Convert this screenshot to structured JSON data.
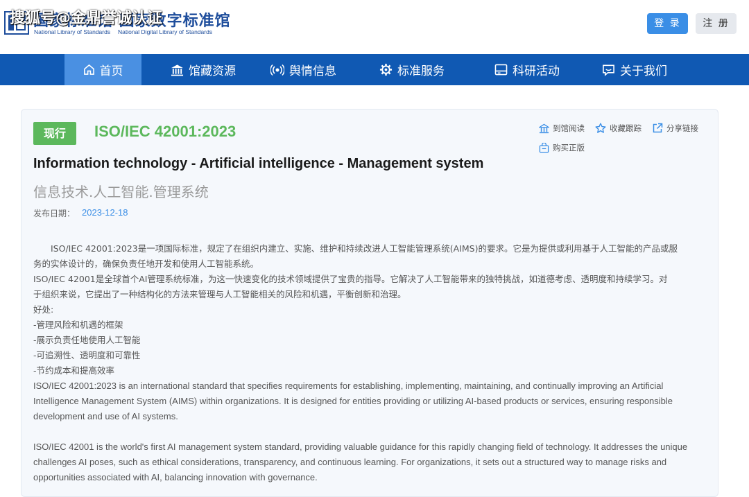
{
  "header": {
    "logo_title": "国家标准馆 国家数字标准馆",
    "logo_sub_left": "National Library of Standards",
    "logo_sub_right": "National Digital Library of Standards",
    "watermark": "搜狐号@金鼎誉诚认证",
    "login_label": "登 录",
    "register_label": "注 册"
  },
  "nav": {
    "items": [
      {
        "label": "首页",
        "icon": "home-icon"
      },
      {
        "label": "馆藏资源",
        "icon": "library-icon"
      },
      {
        "label": "舆情信息",
        "icon": "broadcast-icon"
      },
      {
        "label": "标准服务",
        "icon": "gear-icon"
      },
      {
        "label": "科研活动",
        "icon": "document-icon"
      },
      {
        "label": "关于我们",
        "icon": "chat-icon"
      }
    ]
  },
  "standard": {
    "status": "现行",
    "code": "ISO/IEC 42001:2023",
    "title_en": "Information technology - Artificial intelligence - Management system",
    "title_zh": "信息技术.人工智能.管理系统",
    "pub_label": "发布日期：",
    "pub_date": "2023-12-18"
  },
  "actions": {
    "read": "到馆阅读",
    "favorite": "收藏跟踪",
    "share": "分享链接",
    "buy": "购买正版"
  },
  "description": {
    "zh_lines": [
      "　　ISO/IEC 42001:2023是一项国际标准，规定了在组织内建立、实施、维护和持续改进人工智能管理系统(AIMS)的要求。它是为提供或利用基于人工智能的产品或服",
      "务的实体设计的，确保负责任地开发和使用人工智能系统。",
      "ISO/IEC 42001是全球首个AI管理系统标准，为这一快速变化的技术领域提供了宝贵的指导。它解决了人工智能带来的独特挑战，如道德考虑、透明度和持续学习。对",
      "于组织来说，它提出了一种结构化的方法来管理与人工智能相关的风险和机遇，平衡创新和治理。",
      "好处:",
      "-管理风险和机遇的框架",
      "-展示负责任地使用人工智能",
      "-可追溯性、透明度和可靠性",
      "-节约成本和提高效率"
    ],
    "en_para1": [
      "ISO/IEC 42001:2023 is an international standard that specifies requirements for establishing, implementing, maintaining, and continually improving an Artificial",
      "Intelligence Management System (AIMS) within organizations. It is designed for entities providing or utilizing AI-based products or services, ensuring responsible",
      "development and use of AI systems."
    ],
    "en_para2": [
      "ISO/IEC 42001 is the world's first AI management system standard, providing valuable guidance for this rapidly changing field of technology. It addresses the unique",
      "challenges AI poses, such as ethical considerations, transparency, and continuous learning. For organizations, it sets out a structured way to manage risks and",
      "opportunities associated with AI, balancing innovation with governance."
    ]
  },
  "colors": {
    "nav_bg": "#1059b3",
    "nav_active": "#4a90e2",
    "status_green": "#5cb85c",
    "link_blue": "#3a8ee6"
  }
}
